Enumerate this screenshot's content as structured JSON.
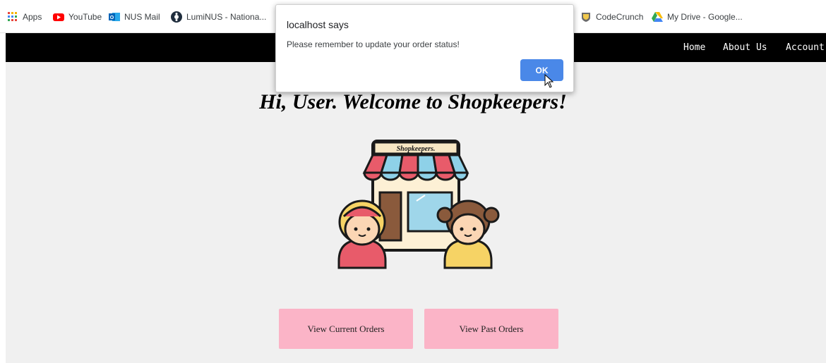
{
  "bookmarks": [
    {
      "label": "Apps",
      "icon": "apps-grid-icon"
    },
    {
      "label": "YouTube",
      "icon": "youtube-icon"
    },
    {
      "label": "NUS Mail",
      "icon": "outlook-icon"
    },
    {
      "label": "LumiNUS - Nationa...",
      "icon": "luminus-icon"
    },
    {
      "label": "CodeCrunch",
      "icon": "codecrunch-icon"
    },
    {
      "label": "My Drive - Google...",
      "icon": "google-drive-icon"
    }
  ],
  "nav": {
    "home": "Home",
    "about": "About Us",
    "account": "Account"
  },
  "main": {
    "welcome": "Hi, User. Welcome to Shopkeepers!",
    "shop_sign": "Shopkeepers.",
    "btn_current": "View Current Orders",
    "btn_past": "View Past Orders"
  },
  "dialog": {
    "title": "localhost says",
    "message": "Please remember to update your order status!",
    "ok": "OK"
  },
  "colors": {
    "navbar": "#000000",
    "background": "#f0f0f0",
    "button": "#fbb4c7",
    "ok": "#4a88e8"
  }
}
